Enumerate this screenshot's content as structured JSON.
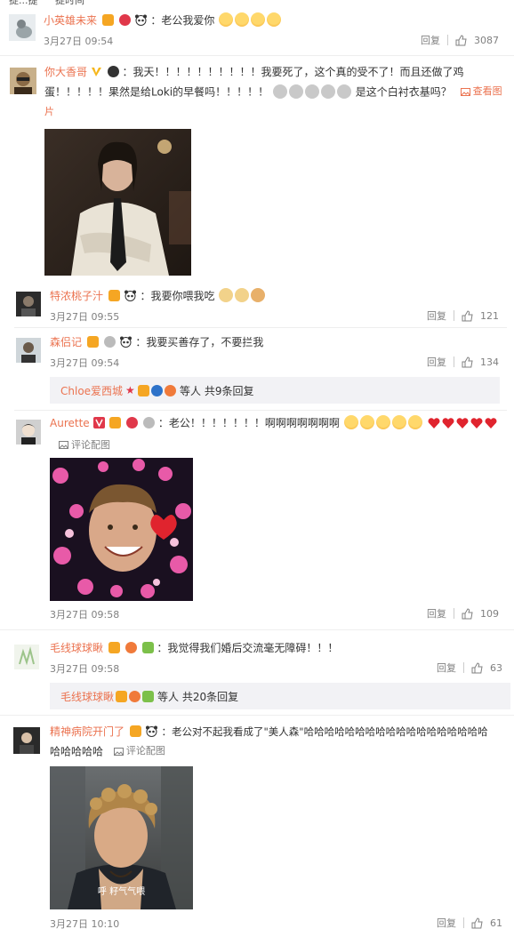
{
  "top_strip": {
    "text1": "捉...捷",
    "text2": "捉时间"
  },
  "comments": [
    {
      "id": "c1",
      "user": "小英雄未来",
      "text": "：老公我爱你",
      "time": "3月27日 09:54",
      "reply_label": "回复",
      "likes": "3087"
    },
    {
      "id": "c2",
      "user": "你大香哥",
      "text_line1": "：我天！！！！！！！！！！我要死了，这个真的受不了！而且还做了鸡",
      "text_line2a": "蛋！！！！！果然是给Loki的早餐吗！！！！！",
      "text_line2b": "是这个白衬衣基吗？",
      "view_image": "查看图",
      "view_image_cont": "片"
    },
    {
      "id": "c3",
      "user": "特浓桃子汁",
      "text": "：我要你喂我吃",
      "time": "3月27日 09:55",
      "reply_label": "回复",
      "likes": "121"
    },
    {
      "id": "c4",
      "user": "森侣记",
      "text": "：我要买善存了，不要拦我",
      "time": "3月27日 09:54",
      "reply_label": "回复",
      "likes": "134",
      "sub_user": "Chloe爱西城",
      "sub_tail": "等人 共9条回复"
    },
    {
      "id": "c5",
      "user": "Aurette",
      "text_a": "：老公！！！！！！！",
      "text_b": "啊啊啊啊啊啊啊",
      "comment_image": "评论配图",
      "time": "3月27日 09:58",
      "reply_label": "回复",
      "likes": "109"
    },
    {
      "id": "c6",
      "user": "毛线球球瞅",
      "text": "：我觉得我们婚后交流毫无障碍！！！",
      "time": "3月27日 09:58",
      "reply_label": "回复",
      "likes": "63",
      "sub_user": "毛线球球瞅",
      "sub_tail": "等人 共20条回复"
    },
    {
      "id": "c7",
      "user": "精神病院开门了",
      "text_line1": "：老公对不起我看成了\"美人森\"哈哈哈哈哈哈哈哈哈哈哈哈哈哈哈哈哈哈",
      "text_line2": "哈哈哈哈哈",
      "comment_image": "评论配图",
      "photo_caption": "呼 籽气气喂",
      "time": "3月27日 10:10",
      "reply_label": "回复",
      "likes": "61"
    }
  ],
  "colors": {
    "name": "#eb7350",
    "meta": "#808080",
    "subbox": "#f2f2f5"
  }
}
